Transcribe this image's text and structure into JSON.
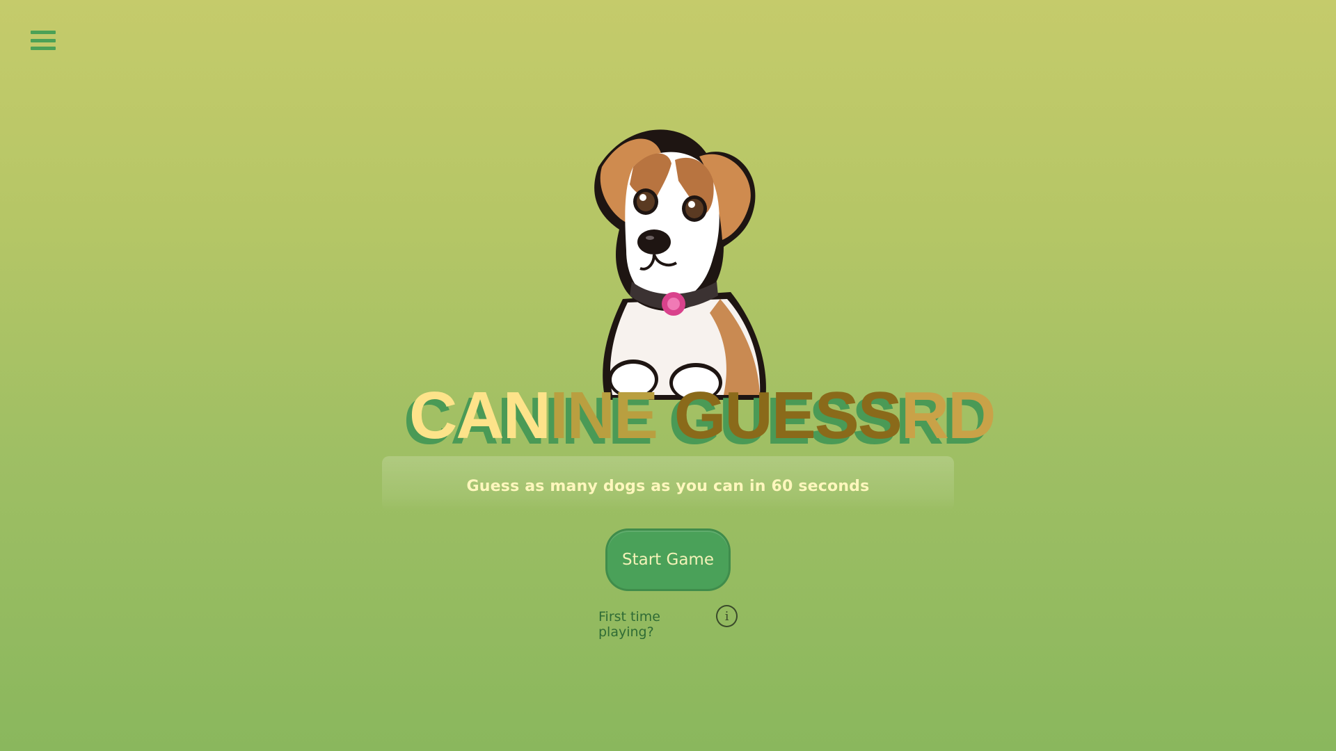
{
  "menu": {
    "icon": "hamburger-menu-icon"
  },
  "hero": {
    "mascot": "puppy-mascot",
    "title_parts": [
      "CAN",
      "INE ",
      "GUESS",
      "RD"
    ]
  },
  "intro": {
    "subtitle": "Guess as many dogs as you can in 60 seconds"
  },
  "actions": {
    "start_label": "Start Game",
    "help_label": "First time playing?",
    "help_icon": "info-icon",
    "help_icon_glyph": "i"
  },
  "colors": {
    "bg_top": "#c5cb6b",
    "bg_bottom": "#8ab75d",
    "accent_green": "#4aa159",
    "title_yellow": "#fde38a",
    "title_brown": "#8a6a1a",
    "title_tan": "#c9a248",
    "subtitle_text": "#fff7bd"
  }
}
